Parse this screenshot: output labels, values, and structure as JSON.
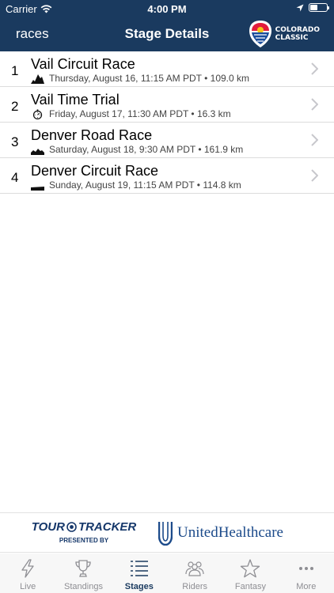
{
  "status_bar": {
    "carrier": "Carrier",
    "time": "4:00 PM"
  },
  "nav": {
    "back_label": "races",
    "title": "Stage Details",
    "logo_line1": "COLORADO",
    "logo_line2": "CLASSIC"
  },
  "stages": [
    {
      "number": "1",
      "title": "Vail Circuit Race",
      "details": "Thursday, August 16, 11:15 AM PDT • 109.0 km",
      "icon": "mountain-icon"
    },
    {
      "number": "2",
      "title": "Vail Time Trial",
      "details": "Friday, August 17, 11:30 AM PDT • 16.3 km",
      "icon": "stopwatch-icon"
    },
    {
      "number": "3",
      "title": "Denver Road Race",
      "details": "Saturday, August 18, 9:30 AM PDT • 161.9 km",
      "icon": "hilly-icon"
    },
    {
      "number": "4",
      "title": "Denver Circuit Race",
      "details": "Sunday, August 19, 11:15 AM PDT • 114.8 km",
      "icon": "flat-icon"
    }
  ],
  "sponsor": {
    "tracker_name_a": "TOUR",
    "tracker_name_b": "TRACKER",
    "presented_by": "PRESENTED BY",
    "partner": "UnitedHealthcare"
  },
  "tabs": [
    {
      "label": "Live",
      "icon": "bolt-icon",
      "active": false
    },
    {
      "label": "Standings",
      "icon": "trophy-icon",
      "active": false
    },
    {
      "label": "Stages",
      "icon": "list-icon",
      "active": true
    },
    {
      "label": "Riders",
      "icon": "riders-icon",
      "active": false
    },
    {
      "label": "Fantasy",
      "icon": "star-icon",
      "active": false
    },
    {
      "label": "More",
      "icon": "more-icon",
      "active": false
    }
  ],
  "colors": {
    "header_bg": "#1a3a5f",
    "active_tab": "#1a3a5f",
    "inactive_tab": "#8e8e93",
    "sponsor_blue": "#15376a"
  }
}
